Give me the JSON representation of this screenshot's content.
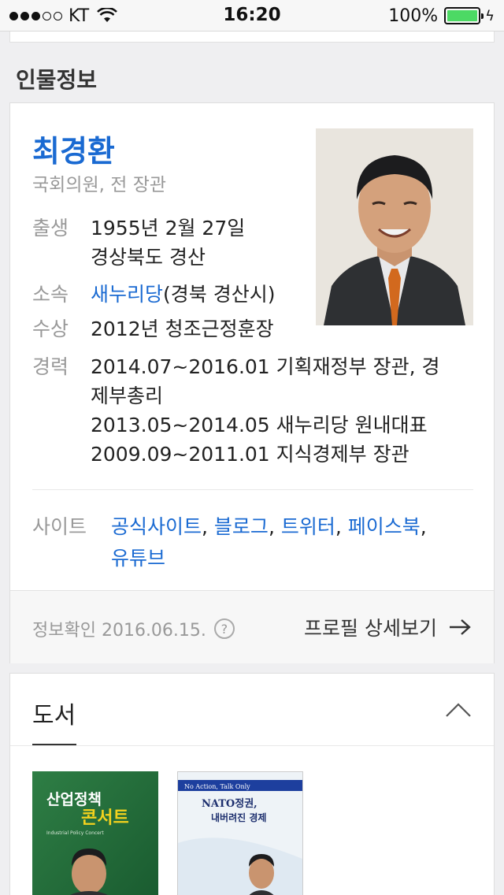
{
  "status_bar": {
    "carrier": "KT",
    "time": "16:20",
    "battery_pct": "100%",
    "signal_bars_filled": 3,
    "signal_bars_total": 5
  },
  "section": {
    "title": "인물정보"
  },
  "profile": {
    "name": "최경환",
    "subtitle": "국회의원, 전 장관",
    "birth": {
      "label": "출생",
      "date": "1955년 2월 27일",
      "place": "경상북도 경산"
    },
    "party": {
      "label": "소속",
      "party_link": "새누리당",
      "district": "(경북 경산시)"
    },
    "award": {
      "label": "수상",
      "value": "2012년 청조근정훈장"
    },
    "career": {
      "label": "경력",
      "items": [
        "2014.07~2016.01 기획재정부 장관, 경",
        "제부총리",
        "2013.05~2014.05 새누리당 원내대표",
        "2009.09~2011.01 지식경제부 장관"
      ]
    },
    "sites": {
      "label": "사이트",
      "links": [
        "공식사이트",
        "블로그",
        "트위터",
        "페이스북",
        "유튜브"
      ],
      "separator": ","
    },
    "footer": {
      "info_label": "정보확인 2016.06.15.",
      "help": "?",
      "more_label": "프로필 상세보기"
    }
  },
  "books": {
    "title": "도서",
    "items": [
      {
        "title": "산업정책 콘서트",
        "title_line1": "산업정책",
        "title_line2": "콘서트",
        "subtitle": "Industrial Policy Concert"
      },
      {
        "title": "NATO 정권, 내버려진 경제",
        "banner": "No Action, Talk Only",
        "title_line1": "NATO정권,",
        "title_line2": "내버려진 경제"
      }
    ]
  },
  "colors": {
    "accent": "#1a6ad2",
    "battery": "#4cd964"
  }
}
